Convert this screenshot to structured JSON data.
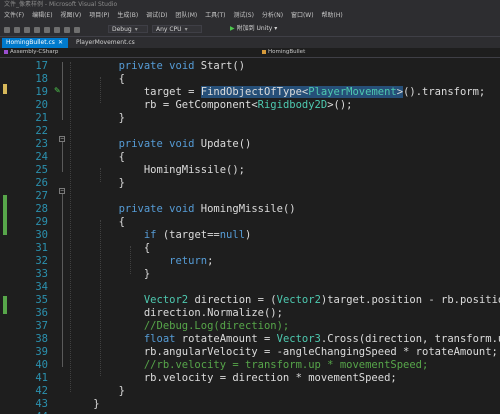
{
  "window": {
    "title": "文件_像素样例 - Microsoft Visual Studio"
  },
  "menu": [
    "文件(F)",
    "编辑(E)",
    "视图(V)",
    "项目(P)",
    "生成(B)",
    "调试(D)",
    "团队(M)",
    "工具(T)",
    "测试(S)",
    "分析(N)",
    "窗口(W)",
    "帮助(H)"
  ],
  "toolbar": {
    "config": "Debug",
    "platform": "Any CPU",
    "attach_label": "附加到 Unity"
  },
  "tabs": [
    "HomingBullet.cs",
    "PlayerMovement.cs"
  ],
  "navbar": {
    "project": "Assembly-CSharp",
    "class": "HomingBullet"
  },
  "editor": {
    "lines": [
      {
        "num": "17",
        "parts": [
          {
            "t": "        "
          },
          {
            "t": "private",
            "c": "kw"
          },
          {
            "t": " "
          },
          {
            "t": "void",
            "c": "kw"
          },
          {
            "t": " Start()"
          }
        ]
      },
      {
        "num": "18",
        "parts": [
          {
            "t": "        {"
          }
        ]
      },
      {
        "num": "19",
        "parts": [
          {
            "t": "            target = "
          },
          {
            "t": "FindObjectOfType<",
            "c": "sel"
          },
          {
            "t": "PlayerMovement",
            "c": "ty sel"
          },
          {
            "t": ">",
            "c": "sel"
          },
          {
            "t": "().transform;"
          }
        ]
      },
      {
        "num": "20",
        "parts": [
          {
            "t": "            rb = GetComponent<"
          },
          {
            "t": "Rigidbody2D",
            "c": "ty"
          },
          {
            "t": ">();"
          }
        ]
      },
      {
        "num": "21",
        "parts": [
          {
            "t": "        }"
          }
        ]
      },
      {
        "num": "22",
        "parts": [
          {
            "t": ""
          }
        ]
      },
      {
        "num": "23",
        "parts": [
          {
            "t": "        "
          },
          {
            "t": "private",
            "c": "kw"
          },
          {
            "t": " "
          },
          {
            "t": "void",
            "c": "kw"
          },
          {
            "t": " Update()"
          }
        ]
      },
      {
        "num": "24",
        "parts": [
          {
            "t": "        {"
          }
        ]
      },
      {
        "num": "25",
        "parts": [
          {
            "t": "            HomingMissile();"
          }
        ]
      },
      {
        "num": "26",
        "parts": [
          {
            "t": "        }"
          }
        ]
      },
      {
        "num": "27",
        "parts": [
          {
            "t": ""
          }
        ]
      },
      {
        "num": "28",
        "parts": [
          {
            "t": "        "
          },
          {
            "t": "private",
            "c": "kw"
          },
          {
            "t": " "
          },
          {
            "t": "void",
            "c": "kw"
          },
          {
            "t": " HomingMissile()"
          }
        ]
      },
      {
        "num": "29",
        "parts": [
          {
            "t": "        {"
          }
        ]
      },
      {
        "num": "30",
        "parts": [
          {
            "t": "            "
          },
          {
            "t": "if",
            "c": "kw"
          },
          {
            "t": " (target=="
          },
          {
            "t": "null",
            "c": "kw"
          },
          {
            "t": ")"
          }
        ]
      },
      {
        "num": "31",
        "parts": [
          {
            "t": "            {"
          }
        ]
      },
      {
        "num": "32",
        "parts": [
          {
            "t": "                "
          },
          {
            "t": "return",
            "c": "kw"
          },
          {
            "t": ";"
          }
        ]
      },
      {
        "num": "33",
        "parts": [
          {
            "t": "            }"
          }
        ]
      },
      {
        "num": "34",
        "parts": [
          {
            "t": ""
          }
        ]
      },
      {
        "num": "35",
        "parts": [
          {
            "t": "            "
          },
          {
            "t": "Vector2",
            "c": "ty"
          },
          {
            "t": " direction = ("
          },
          {
            "t": "Vector2",
            "c": "ty"
          },
          {
            "t": ")target.position - rb.position;"
          }
        ]
      },
      {
        "num": "36",
        "parts": [
          {
            "t": "            direction.Normalize();"
          }
        ]
      },
      {
        "num": "37",
        "parts": [
          {
            "t": "            "
          },
          {
            "t": "//Debug.Log(direction);",
            "c": "cm"
          }
        ]
      },
      {
        "num": "38",
        "parts": [
          {
            "t": "            "
          },
          {
            "t": "float",
            "c": "kw"
          },
          {
            "t": " rotateAmount = "
          },
          {
            "t": "Vector3",
            "c": "ty"
          },
          {
            "t": ".Cross(direction, transform.up).z;"
          }
        ]
      },
      {
        "num": "39",
        "parts": [
          {
            "t": "            rb.angularVelocity = -angleChangingSpeed * rotateAmount;"
          }
        ]
      },
      {
        "num": "40",
        "parts": [
          {
            "t": "            "
          },
          {
            "t": "//rb.velocity = transform.up * movementSpeed;",
            "c": "cm"
          }
        ]
      },
      {
        "num": "41",
        "parts": [
          {
            "t": "            rb.velocity = direction * movementSpeed;"
          }
        ]
      },
      {
        "num": "42",
        "parts": [
          {
            "t": "        }"
          }
        ]
      },
      {
        "num": "43",
        "parts": [
          {
            "t": "    }"
          }
        ]
      },
      {
        "num": "44",
        "parts": [
          {
            "t": ""
          }
        ]
      }
    ]
  },
  "colors": {
    "keyword": "#569cd6",
    "type": "#4ec9b0",
    "comment": "#57a64a",
    "line_number": "#2b91af",
    "selection": "#264f78",
    "accent": "#007acc"
  }
}
